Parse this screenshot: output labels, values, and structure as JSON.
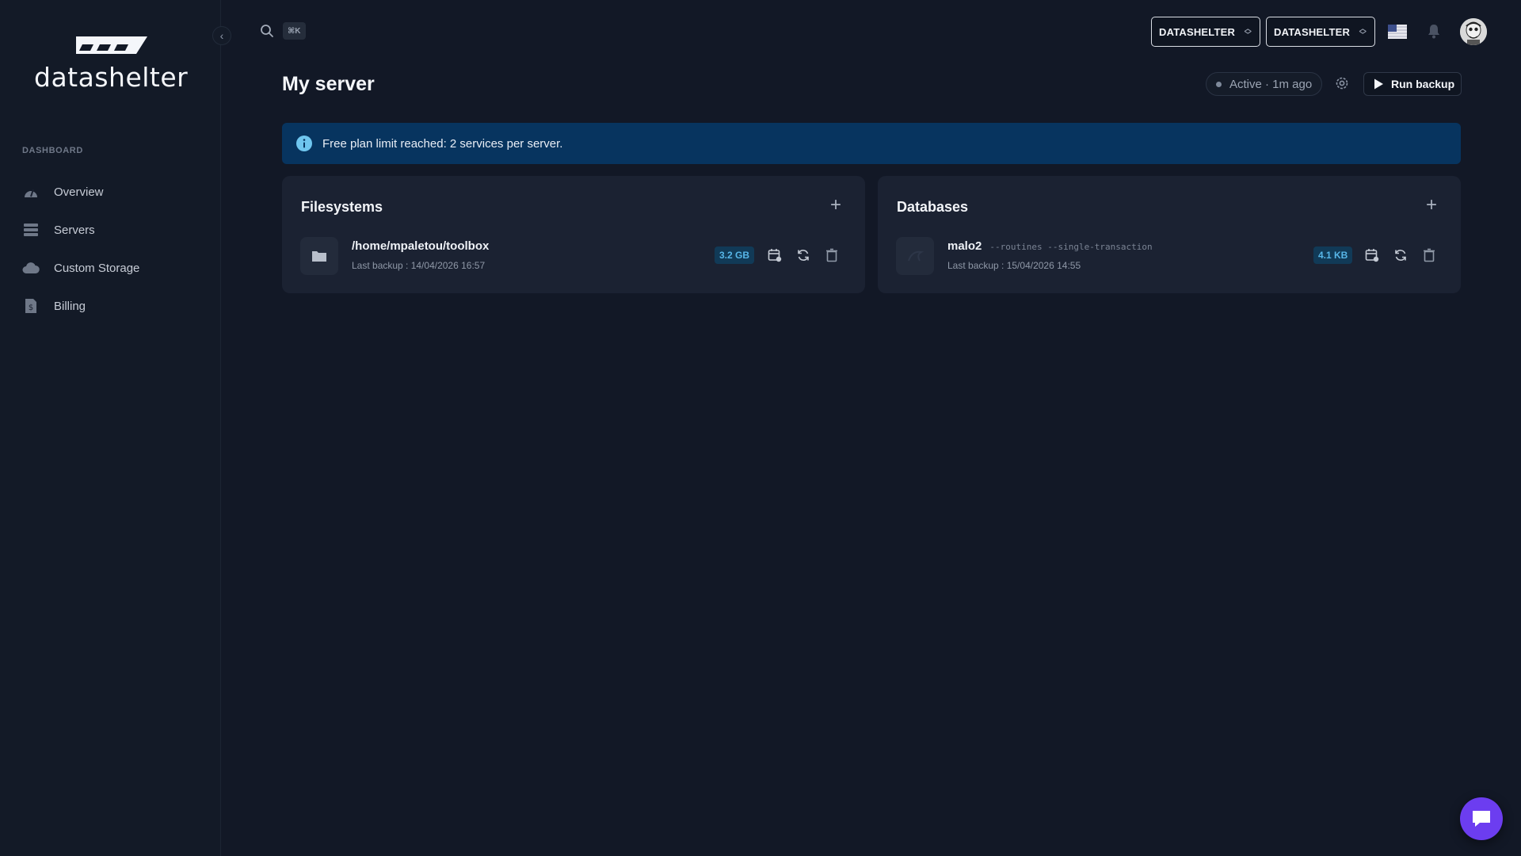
{
  "sidebar": {
    "brand": "datashelter",
    "section_label": "DASHBOARD",
    "items": [
      {
        "label": "Overview",
        "icon": "speedometer-icon"
      },
      {
        "label": "Servers",
        "icon": "server-stack-icon"
      },
      {
        "label": "Custom Storage",
        "icon": "cloud-icon"
      },
      {
        "label": "Billing",
        "icon": "billing-icon"
      }
    ]
  },
  "topbar": {
    "shortcut": "⌘K",
    "org_select_1": "DATASHELTER",
    "org_select_2": "DATASHELTER"
  },
  "page": {
    "title": "My server",
    "status": "Active · 1m ago",
    "run_backup": "Run backup"
  },
  "banner": {
    "text": "Free plan limit reached: 2 services per server."
  },
  "filesystems": {
    "title": "Filesystems",
    "items": [
      {
        "name": "/home/mpaletou/toolbox",
        "last_backup": "Last backup : 14/04/2026 16:57",
        "size": "3.2 GB"
      }
    ]
  },
  "databases": {
    "title": "Databases",
    "items": [
      {
        "name": "malo2",
        "flags": "--routines --single-transaction",
        "last_backup": "Last backup : 15/04/2026 14:55",
        "size": "4.1 KB"
      }
    ]
  },
  "colors": {
    "background": "#121826",
    "card": "#1b2232",
    "banner": "#07345f",
    "size_badge_text": "#57b6e8",
    "chat_fab": "#6c3df0"
  }
}
